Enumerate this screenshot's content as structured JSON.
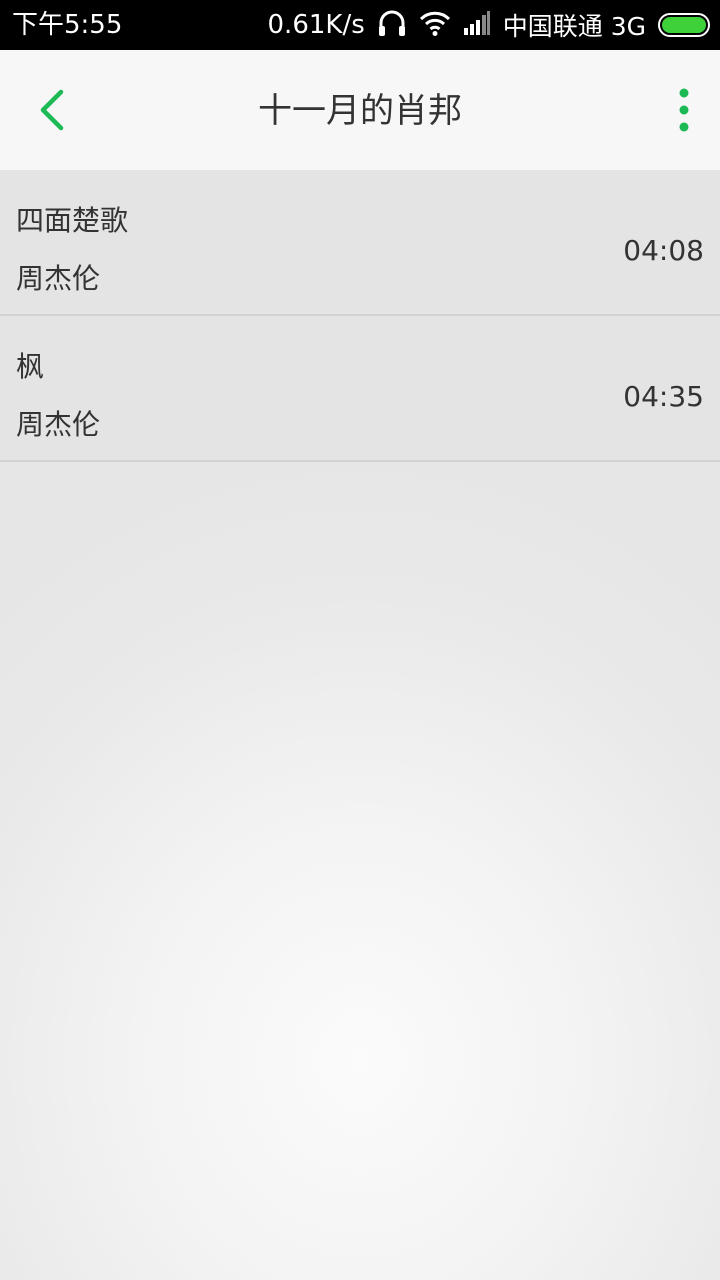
{
  "status_bar": {
    "time": "下午5:55",
    "net_speed": "0.61K/s",
    "carrier": "中国联通 3G",
    "battery_color": "#3ed13a"
  },
  "header": {
    "title": "十一月的肖邦",
    "accent": "#1db954",
    "back_icon": "chevron-left-icon",
    "more_icon": "more-vertical-icon"
  },
  "songs": [
    {
      "title": "四面楚歌",
      "artist": "周杰伦",
      "duration": "04:08"
    },
    {
      "title": "枫",
      "artist": "周杰伦",
      "duration": "04:35"
    }
  ]
}
